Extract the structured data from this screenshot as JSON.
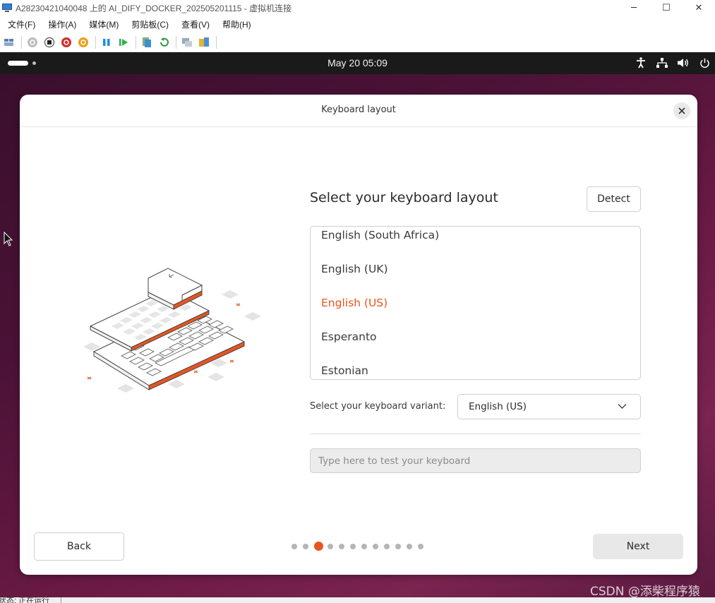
{
  "host_window": {
    "title": "A28230421040048 上的 AI_DIFY_DOCKER_202505201115 - 虚拟机连接",
    "controls": {
      "minimize": "─",
      "maximize": "☐",
      "close": "✕"
    },
    "menu": [
      "文件(F)",
      "操作(A)",
      "媒体(M)",
      "剪贴板(C)",
      "查看(V)",
      "帮助(H)"
    ],
    "toolbar_icons": [
      "ctrl-alt-del-icon",
      "start-icon",
      "stop-icon",
      "shutdown-icon",
      "save-state-icon",
      "pause-icon",
      "resume-icon",
      "checkpoint-icon",
      "revert-icon",
      "enhanced-session-icon",
      "share-icon"
    ],
    "status_text": "状态: 正在运行"
  },
  "gnome_panel": {
    "clock": "May 20  05:09",
    "tray_icons": [
      "accessibility-icon",
      "network-icon",
      "volume-icon",
      "power-icon"
    ]
  },
  "dialog": {
    "title": "Keyboard layout",
    "heading": "Select your keyboard layout",
    "detect_label": "Detect",
    "layouts": [
      "English (South Africa)",
      "English (UK)",
      "English (US)",
      "Esperanto",
      "Estonian"
    ],
    "selected_layout": "English (US)",
    "variant_label": "Select your keyboard variant:",
    "variant_value": "English (US)",
    "test_placeholder": "Type here to test your keyboard",
    "back_label": "Back",
    "next_label": "Next",
    "progress": {
      "total_steps": 12,
      "current_step": 3
    }
  },
  "watermark": "CSDN @添柴程序猿",
  "colors": {
    "accent": "#E95420",
    "panel": "#1A1A1A",
    "desktop": "#4A1236"
  }
}
